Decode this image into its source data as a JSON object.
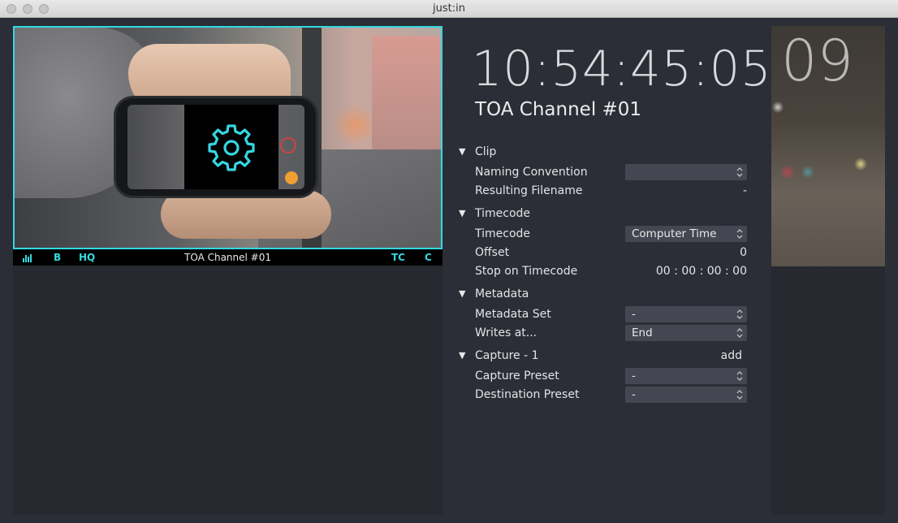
{
  "window": {
    "title": "just:in"
  },
  "preview": {
    "bar": {
      "level_icon": "audio-level-icon",
      "b": "B",
      "hq": "HQ",
      "title": "TOA Channel #01",
      "tc": "TC",
      "c": "C"
    },
    "center_icon": "gear-icon",
    "accent": "#34d8e0"
  },
  "inspector": {
    "timecode": "10:54:45:05",
    "channel_title": "TOA Channel #01",
    "clip": {
      "heading": "Clip",
      "naming_convention": {
        "label": "Naming Convention",
        "value": ""
      },
      "resulting_filename": {
        "label": "Resulting Filename",
        "value": "-"
      }
    },
    "timecode_section": {
      "heading": "Timecode",
      "timecode": {
        "label": "Timecode",
        "value": "Computer Time"
      },
      "offset": {
        "label": "Offset",
        "value": "0"
      },
      "stop_on_timecode": {
        "label": "Stop on Timecode",
        "value": "00 : 00 : 00 : 00"
      }
    },
    "metadata": {
      "heading": "Metadata",
      "metadata_set": {
        "label": "Metadata Set",
        "value": "-"
      },
      "writes_at": {
        "label": "Writes at...",
        "value": "End"
      }
    },
    "capture": {
      "heading": "Capture - 1",
      "add_label": "add",
      "capture_preset": {
        "label": "Capture Preset",
        "value": "-"
      },
      "destination_preset": {
        "label": "Destination Preset",
        "value": "-"
      }
    }
  },
  "right_thumbnail": {
    "number": "09"
  }
}
